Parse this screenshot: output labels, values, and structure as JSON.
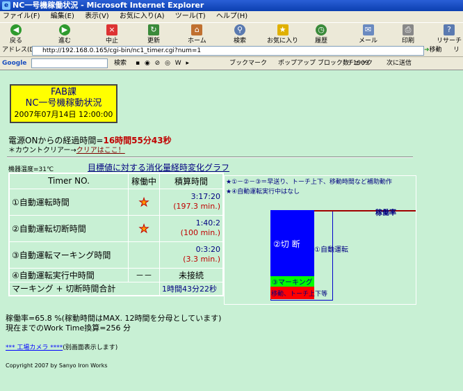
{
  "window": {
    "title": "NC一号機稼働状況 - Microsoft Internet Explorer"
  },
  "menu": [
    "ファイル(F)",
    "編集(E)",
    "表示(V)",
    "お気に入り(A)",
    "ツール(T)",
    "ヘルプ(H)"
  ],
  "toolbar": {
    "back": "戻る",
    "forward": "進む",
    "stop": "中止",
    "refresh": "更新",
    "home": "ホーム",
    "search": "検索",
    "favorites": "お気に入り",
    "history": "履歴",
    "mail": "メール",
    "print": "印刷",
    "research": "リサーチ"
  },
  "address": {
    "label": "アドレス(D)",
    "url": "http://192.168.0.165/cgi-bin/nc1_timer.cgi?num=1",
    "go": "移動",
    "links": "リン"
  },
  "google": {
    "logo": "Google",
    "search": "検索",
    "bookmark": "ブックマーク",
    "popup": "ポップアップ ブロック数: 1909",
    "check": "チェック",
    "send": "次に送信"
  },
  "page": {
    "fab_title": "FAB課",
    "machine": "NC一号機稼動状況",
    "datetime": "2007年07月14日 12:00:00",
    "elapsed_label": "電源ONからの経過時間=",
    "elapsed_value": "16時間55分43秒",
    "clear_prefix": "＊カウントクリアー→",
    "clear_link": "クリアはここ！",
    "temp": "機器温度=31℃",
    "graph_title": "目標値に対する消化量経時変化グラフ",
    "table": {
      "h_timer": "Timer NO.",
      "h_running": "稼働中",
      "h_total": "積算時間",
      "rows": [
        {
          "label": "①自動運転時間",
          "time": "3:17:20",
          "min": "(197.3 min.)"
        },
        {
          "label": "②自動運転切断時間",
          "time": "1:40:2",
          "min": "(100 min.)"
        },
        {
          "label": "③自動運転マーキング時間",
          "time": "0:3:20",
          "min": "(3.3 min.)"
        }
      ],
      "row4_label": "④自動運転実行中時間",
      "row4_running": "－－",
      "row4_total": "未接続",
      "total_label": "マーキング + 切断時間合計",
      "total_value": "1時間43分22秒"
    },
    "legend": {
      "line1": "★①－②－③＝早送り、トーチ上下、移動時間など補助動作",
      "line2": "★④自動運転実行中はなし"
    },
    "chart": {
      "cut": "②切 断",
      "marking": "③マーキング",
      "move": "移動、トーチ上下等",
      "auto": "①自動運転",
      "rate": "稼働率"
    },
    "rate_text": "稼働率=65.8 %(稼動時間はMAX. 12時間を分母としています)",
    "worktime": "現在までのWork Time換算=256 分",
    "camera_link": "*** 工場カメラ ****",
    "camera_note": "(別画面表示します)",
    "copyright": "Copyright 2007 by Sanyo Iron Works"
  }
}
